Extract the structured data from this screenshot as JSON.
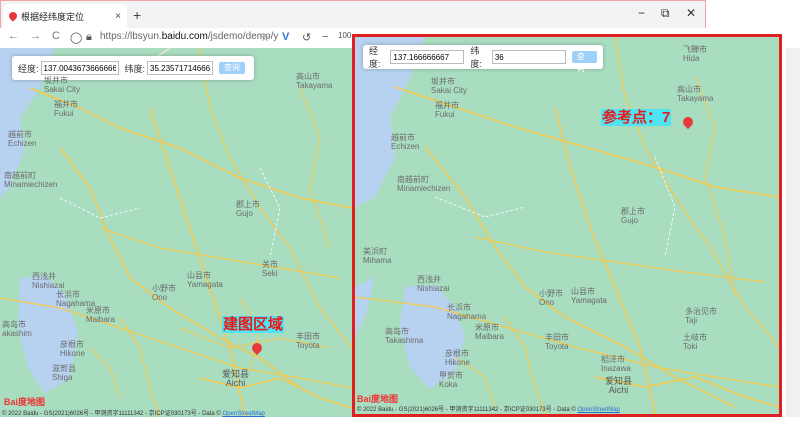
{
  "tab": {
    "title": "根据经纬度定位",
    "close": "×",
    "new_tab": "+"
  },
  "window": {
    "minimize": "−",
    "restore": "⧉",
    "close": "✕"
  },
  "toolbar": {
    "back": "←",
    "forward": "→",
    "reload": "C",
    "url_prefix": "https://lbsyun.",
    "url_domain": "baidu.com",
    "url_suffix": "/jsdemo/demo/y",
    "zoom_text": "100"
  },
  "left_panel": {
    "lng_label": "经度:",
    "lng_value": "137.0043673666666",
    "lat_label": "纬度:",
    "lat_value": "35.235717146666",
    "query_button": "查询",
    "annotation": "建图区域",
    "province_cn": "爱知县",
    "province_en": "Aichi"
  },
  "right_panel": {
    "lng_label": "经度:",
    "lng_value": "137.166666667",
    "lat_label": "纬度:",
    "lat_value": "36",
    "query_button": "查询",
    "annotation": "参考点：7",
    "province_cn": "爱知县",
    "province_en": "Aichi"
  },
  "places_left": [
    {
      "name": "坂井市\nSakai City"
    },
    {
      "name": "福井市\nFukui"
    },
    {
      "name": "越前市\nEchizen"
    },
    {
      "name": "高山市\nTakayama"
    },
    {
      "name": "南越前町\nMinamiechizen"
    },
    {
      "name": "郡上市\nGujo"
    },
    {
      "name": "关市\nSeki"
    },
    {
      "name": "山县市\nYamagata"
    },
    {
      "name": "西浅井\nNishiazai"
    },
    {
      "name": "长浜市\nNagahama"
    },
    {
      "name": "米原市\nMaibara"
    },
    {
      "name": "小野市\nOno"
    },
    {
      "name": "高岛市\nakashim"
    },
    {
      "name": "彦根市\nHikone"
    },
    {
      "name": "丰田市\nToyota"
    },
    {
      "name": "滋贺县\nShiga"
    }
  ],
  "places_right": [
    {
      "name": "坂井市\nSakai City"
    },
    {
      "name": "福井市\nFukui"
    },
    {
      "name": "飞騨市\nHida"
    },
    {
      "name": "高山市\nTakayama"
    },
    {
      "name": "越前市\nEchizen"
    },
    {
      "name": "南越前町\nMinamiechizen"
    },
    {
      "name": "郡上市\nGujo"
    },
    {
      "name": "美浜町\nMihama"
    },
    {
      "name": "西浅井\nNishiazai"
    },
    {
      "name": "长浜市\nNagahama"
    },
    {
      "name": "小野市\nOno"
    },
    {
      "name": "山县市\nYamagata"
    },
    {
      "name": "米原市\nMaibara"
    },
    {
      "name": "高岛市\nTakashima"
    },
    {
      "name": "彦根市\nHikone"
    },
    {
      "name": "稻泽市\nInazawa"
    },
    {
      "name": "丰田市\nToyota"
    },
    {
      "name": "多治见市\nTaji"
    },
    {
      "name": "土岐市\nToki"
    },
    {
      "name": "甲贺市\nKoka"
    }
  ],
  "copyright_left": "© 2022 Baidu - GS(2021)6026号 - 甲测资字11111342 - 京ICP证030173号 - Data ©",
  "copyright_right": "© 2022 Baidu - GS(2021)6026号 - 甲测资字11111342 - 京ICP证030173号 - Data ©",
  "osm_link": "OpenStreetMap",
  "baidu_logo": "Bai度地图",
  "colors": {
    "map_land": "#a9ddc0",
    "water": "#b7d2f0",
    "road": "#f5c84a",
    "frame": "#e02020",
    "highlight": "#4fe4f2",
    "annotation": "#e71a1a"
  }
}
